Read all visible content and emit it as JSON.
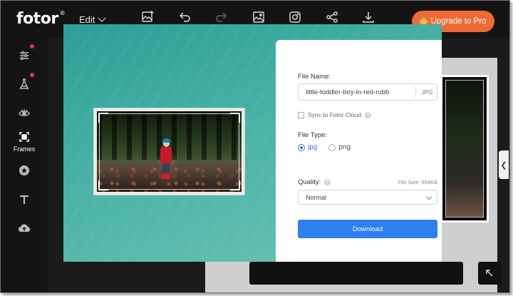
{
  "app": {
    "logo_text": "fotor",
    "logo_mark": "®"
  },
  "topbar": {
    "edit_label": "Edit",
    "icons": [
      "add-image-icon",
      "undo-icon",
      "redo-icon",
      "image-icon",
      "instagram-icon",
      "share-icon",
      "download-icon"
    ],
    "upgrade_label": "Upgrade to Pro",
    "upgrade_color": "#ee6a34"
  },
  "sidebar": {
    "items": [
      {
        "name": "adjust",
        "icon": "sliders-icon",
        "label": "",
        "badge": true
      },
      {
        "name": "effects",
        "icon": "flask-icon",
        "label": "",
        "badge": true
      },
      {
        "name": "beauty",
        "icon": "eye-icon",
        "label": "",
        "badge": false
      },
      {
        "name": "frames",
        "icon": "frame-icon",
        "label": "Frames",
        "badge": false
      },
      {
        "name": "stickers",
        "icon": "star-icon",
        "label": "",
        "badge": false
      },
      {
        "name": "text",
        "icon": "text-icon",
        "label": "",
        "badge": false
      },
      {
        "name": "upload",
        "icon": "cloud-upload-icon",
        "label": "",
        "badge": false
      }
    ]
  },
  "export_dialog": {
    "file_name_label": "File Name:",
    "file_name_value": "little-toddler-boy-in-red-rubb",
    "file_ext": ".JPG",
    "sync_label": "Sync to Fotor Cloud",
    "sync_checked": false,
    "file_type_label": "File Type:",
    "file_types": [
      {
        "label": "jpg",
        "selected": true
      },
      {
        "label": "png",
        "selected": false
      }
    ],
    "quality_label": "Quality:",
    "file_size": "File Size: 654KB",
    "quality_value": "Normal",
    "download_label": "Download",
    "accent_color": "#2e80f0"
  }
}
